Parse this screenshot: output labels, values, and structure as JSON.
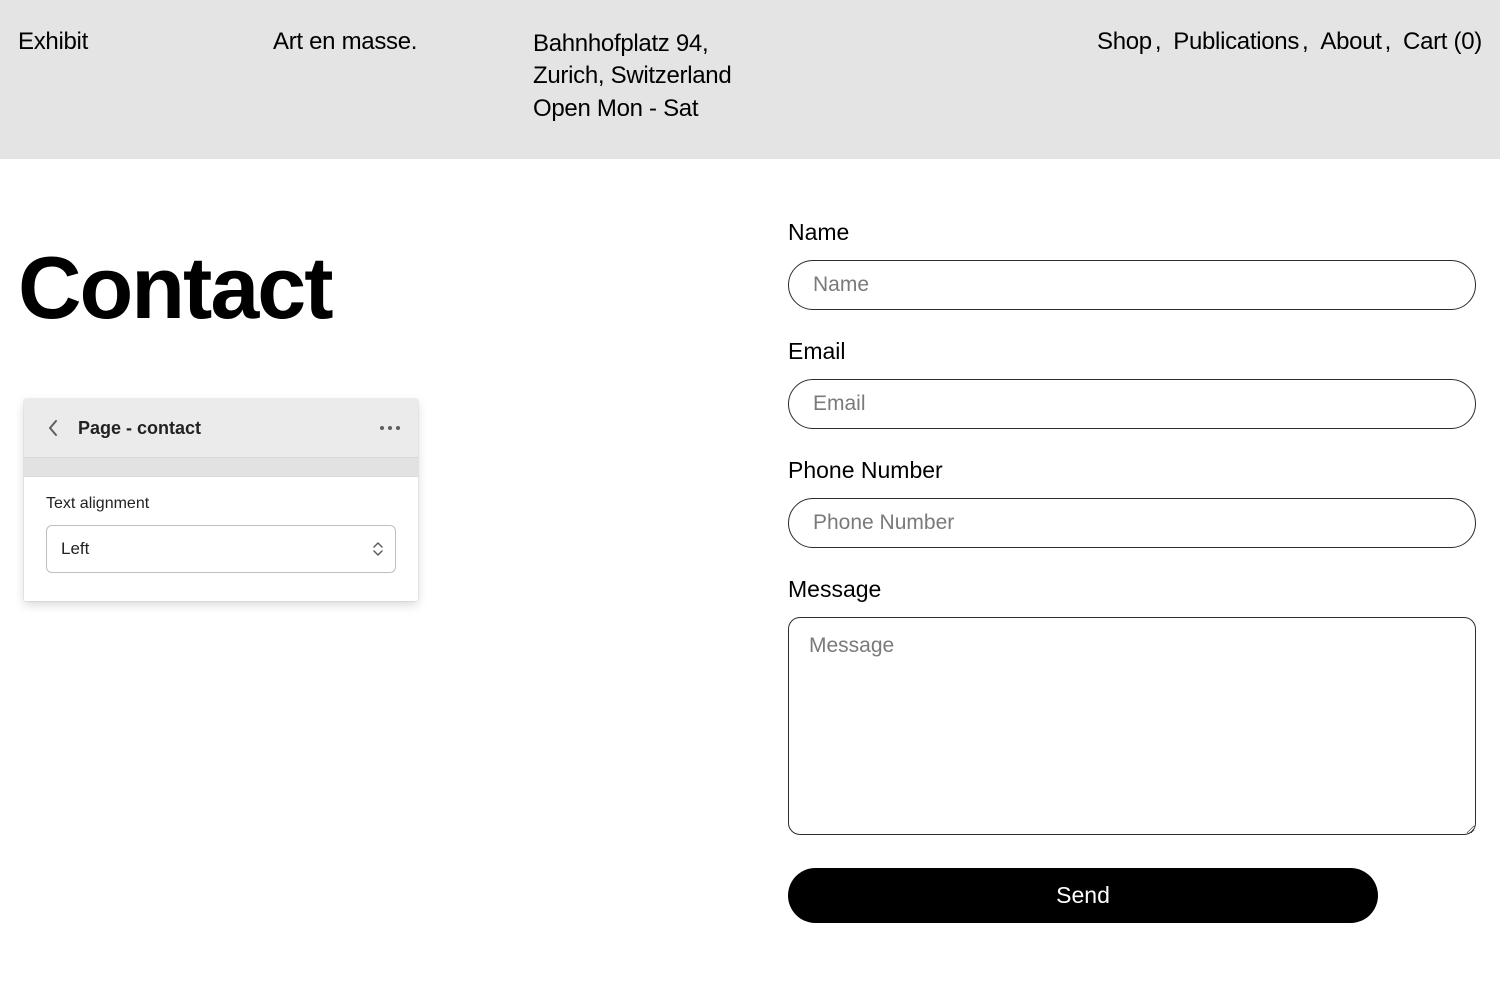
{
  "header": {
    "brand": "Exhibit",
    "tagline": "Art en masse.",
    "address_line1": "Bahnhofplatz 94,",
    "address_line2": "Zurich, Switzerland",
    "address_line3": "Open Mon - Sat",
    "nav": {
      "shop": "Shop",
      "publications": "Publications",
      "about": "About",
      "cart_label": "Cart",
      "cart_count": "0"
    }
  },
  "page": {
    "title": "Contact"
  },
  "panel": {
    "title": "Page - contact",
    "setting_label": "Text alignment",
    "setting_value": "Left"
  },
  "form": {
    "name_label": "Name",
    "name_placeholder": "Name",
    "email_label": "Email",
    "email_placeholder": "Email",
    "phone_label": "Phone Number",
    "phone_placeholder": "Phone Number",
    "message_label": "Message",
    "message_placeholder": "Message",
    "submit_label": "Send"
  }
}
